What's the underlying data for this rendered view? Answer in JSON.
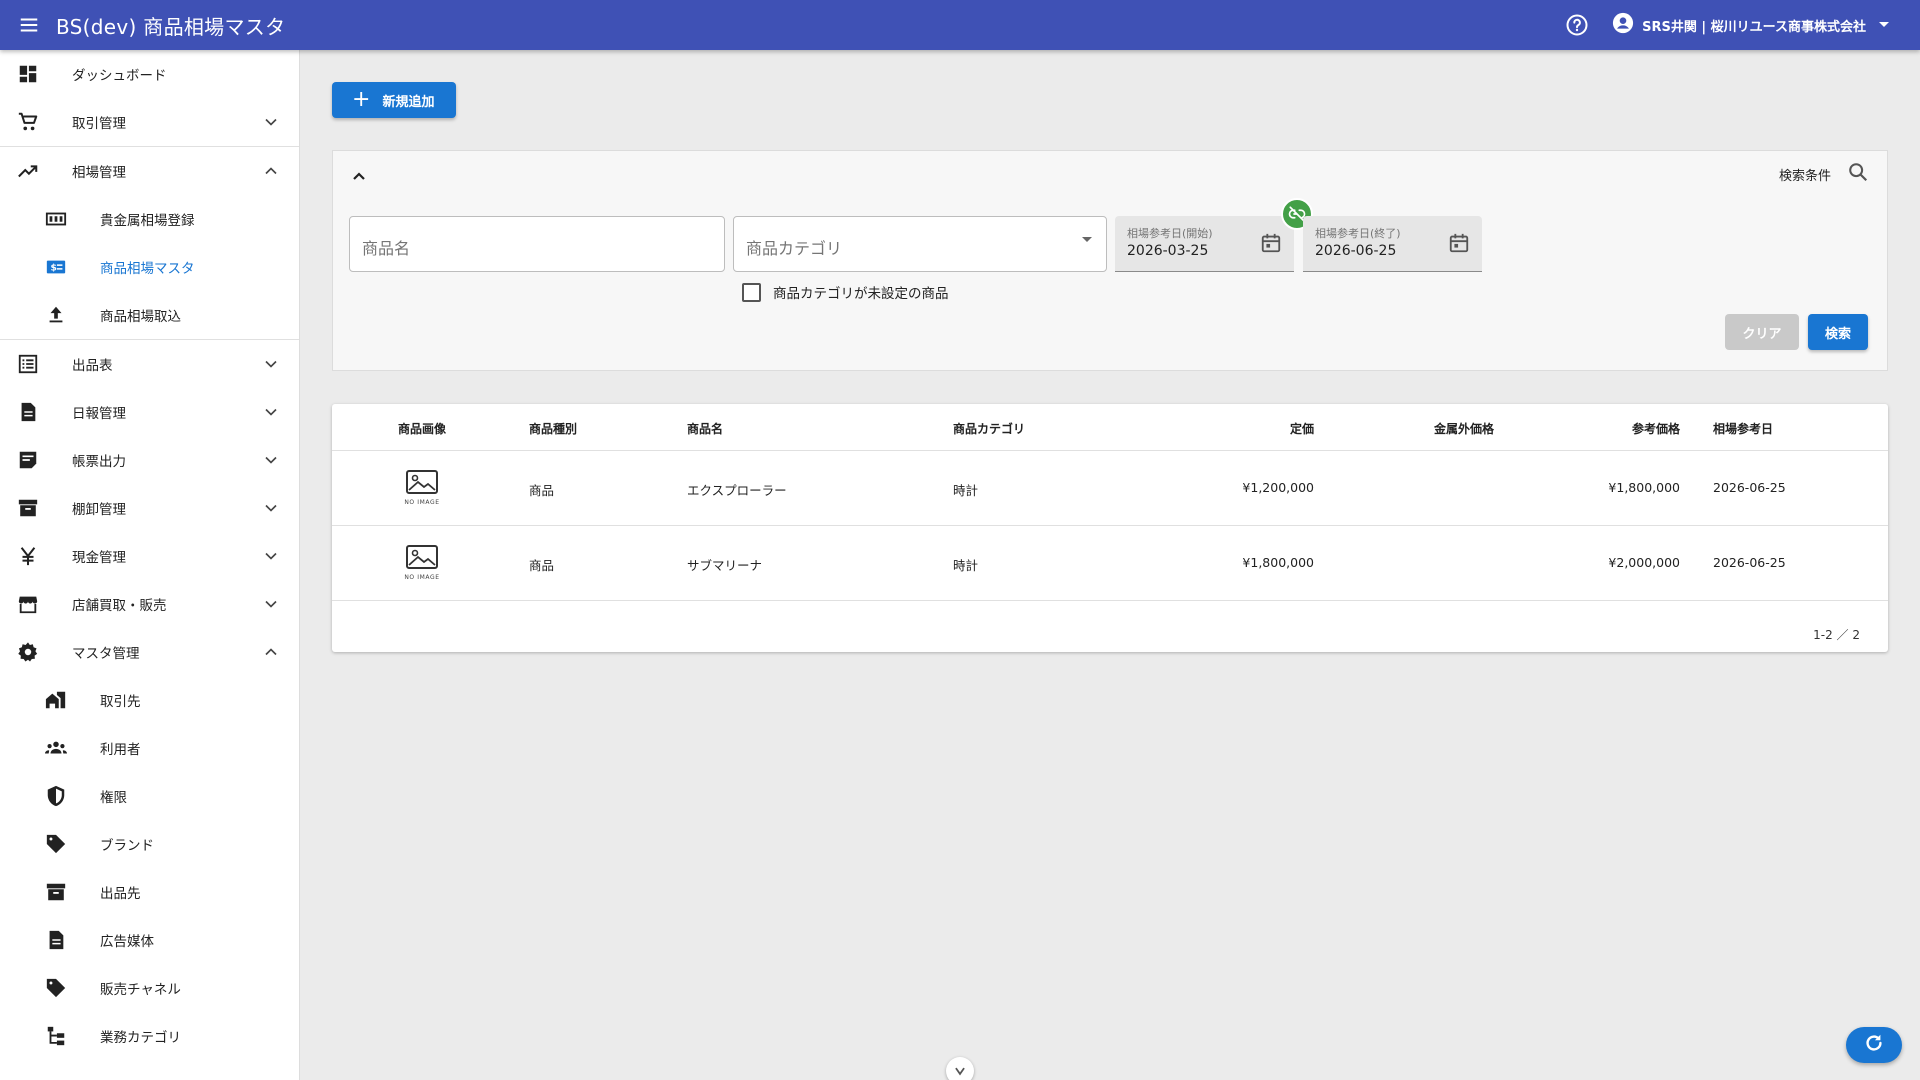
{
  "app": {
    "title": "BS(dev) 商品相場マスタ",
    "account_name": "SRS井関 | 桜川リユース商事株式会社"
  },
  "colors": {
    "appbar": "#3f51b5",
    "primary": "#1976d2",
    "link_badge": "#43a047"
  },
  "sidebar": {
    "items": [
      {
        "label": "ダッシュボード",
        "icon": "dashboard-icon"
      },
      {
        "label": "取引管理",
        "icon": "cart-icon"
      },
      {
        "label": "相場管理",
        "icon": "trending-up-icon"
      },
      {
        "label": "貴金属相場登録",
        "icon": "gold-bar-icon"
      },
      {
        "label": "商品相場マスタ",
        "icon": "price-tag-icon"
      },
      {
        "label": "商品相場取込",
        "icon": "upload-icon"
      },
      {
        "label": "出品表",
        "icon": "list-icon"
      },
      {
        "label": "日報管理",
        "icon": "document-icon"
      },
      {
        "label": "帳票出力",
        "icon": "note-icon"
      },
      {
        "label": "棚卸管理",
        "icon": "archive-icon"
      },
      {
        "label": "現金管理",
        "icon": "yen-icon"
      },
      {
        "label": "店舗買取・販売",
        "icon": "store-icon"
      },
      {
        "label": "マスタ管理",
        "icon": "gear-icon"
      },
      {
        "label": "取引先",
        "icon": "building-icon"
      },
      {
        "label": "利用者",
        "icon": "people-icon"
      },
      {
        "label": "権限",
        "icon": "shield-icon"
      },
      {
        "label": "ブランド",
        "icon": "tag-icon"
      },
      {
        "label": "出品先",
        "icon": "archive-icon"
      },
      {
        "label": "広告媒体",
        "icon": "document-icon"
      },
      {
        "label": "販売チャネル",
        "icon": "tag-icon"
      },
      {
        "label": "業務カテゴリ",
        "icon": "hierarchy-icon"
      }
    ]
  },
  "toolbar": {
    "add_label": "新規追加"
  },
  "search": {
    "condition_label": "検索条件",
    "product_name_placeholder": "商品名",
    "category_placeholder": "商品カテゴリ",
    "date_start_label": "相場参考日(開始)",
    "date_start_value": "2026-03-25",
    "date_end_label": "相場参考日(終了)",
    "date_end_value": "2026-06-25",
    "unset_category_label": "商品カテゴリが未設定の商品",
    "unset_category_checked": false,
    "clear_label": "クリア",
    "search_label": "検索"
  },
  "table": {
    "headers": [
      "商品画像",
      "商品種別",
      "商品名",
      "商品カテゴリ",
      "定価",
      "金属外価格",
      "参考価格",
      "相場参考日"
    ],
    "no_image_text": "NO IMAGE",
    "rows": [
      {
        "type": "商品",
        "name": "エクスプローラー",
        "category": "時計",
        "list_price": "¥1,200,000",
        "non_metal_price": "",
        "ref_price": "¥1,800,000",
        "ref_date": "2026-06-25"
      },
      {
        "type": "商品",
        "name": "サブマリーナ",
        "category": "時計",
        "list_price": "¥1,800,000",
        "non_metal_price": "",
        "ref_price": "¥2,000,000",
        "ref_date": "2026-06-25"
      }
    ],
    "pagination": "1-2 ／ 2"
  }
}
